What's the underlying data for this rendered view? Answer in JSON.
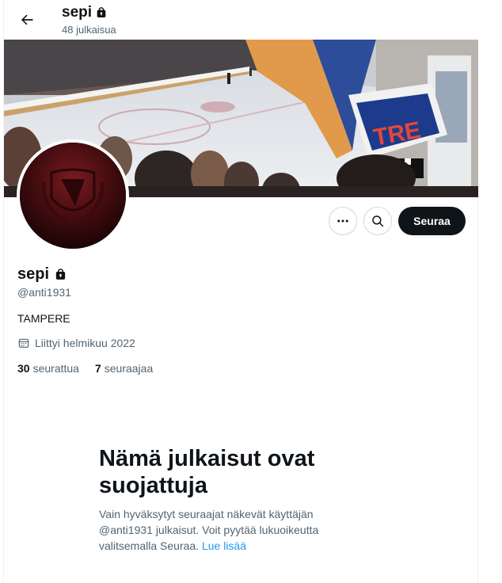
{
  "header": {
    "name": "sepi",
    "post_count": "48 julkaisua"
  },
  "profile": {
    "name": "sepi",
    "handle": "@anti1931",
    "bio": "TAMPERE",
    "joined": "Liittyi helmikuu 2022",
    "following_count": "30",
    "following_label": "seurattua",
    "followers_count": "7",
    "followers_label": "seuraajaa"
  },
  "actions": {
    "follow_label": "Seuraa"
  },
  "protected_notice": {
    "title": "Nämä julkaisut ovat suojattuja",
    "body": "Vain hyväksytyt seuraajat näkevät käyttäjän @anti1931 julkaisut. Voit pyytää lukuoikeutta valitsemalla Seuraa.",
    "link_label": "Lue lisää"
  },
  "icons": {
    "back": "arrow-left-icon",
    "lock": "lock-icon",
    "more": "more-icon",
    "search": "search-icon",
    "calendar": "calendar-icon"
  },
  "colors": {
    "text_primary": "#0f1419",
    "text_secondary": "#536471",
    "link": "#1d9bf0",
    "button_dark": "#0f1419",
    "border": "#cfd9de"
  }
}
